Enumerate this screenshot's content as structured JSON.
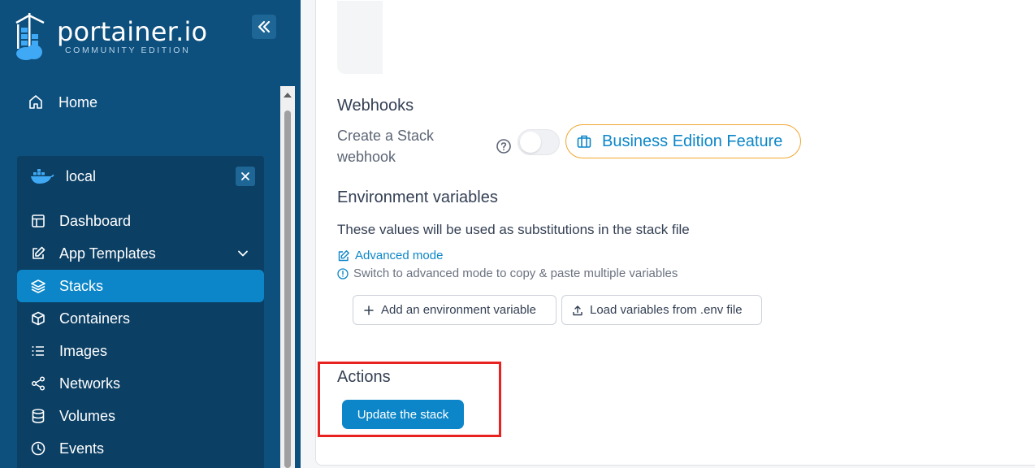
{
  "brand": {
    "name": "portainer.io",
    "edition": "COMMUNITY EDITION"
  },
  "sidebar": {
    "home_label": "Home",
    "environment": {
      "name": "local",
      "items": [
        {
          "label": "Dashboard",
          "icon": "dashboard-icon"
        },
        {
          "label": "App Templates",
          "icon": "edit-icon",
          "expandable": true
        },
        {
          "label": "Stacks",
          "icon": "layers-icon",
          "active": true
        },
        {
          "label": "Containers",
          "icon": "box-icon"
        },
        {
          "label": "Images",
          "icon": "list-icon"
        },
        {
          "label": "Networks",
          "icon": "share-icon"
        },
        {
          "label": "Volumes",
          "icon": "database-icon"
        },
        {
          "label": "Events",
          "icon": "clock-icon"
        }
      ]
    }
  },
  "webhooks": {
    "title": "Webhooks",
    "label_line1": "Create a Stack",
    "label_line2": "webhook",
    "toggle_on": false,
    "badge": "Business Edition Feature"
  },
  "env_vars": {
    "title": "Environment variables",
    "description": "These values will be used as substitutions in the stack file",
    "advanced_link": "Advanced mode",
    "hint": "Switch to advanced mode to copy & paste multiple variables",
    "add_button": "Add an environment variable",
    "load_button": "Load variables from .env file"
  },
  "actions": {
    "title": "Actions",
    "update_button": "Update the stack"
  },
  "colors": {
    "sidebar_bg": "#0d4f7d",
    "accent": "#0c86c8",
    "badge_border": "#f0a730",
    "highlight": "#e8231f"
  }
}
